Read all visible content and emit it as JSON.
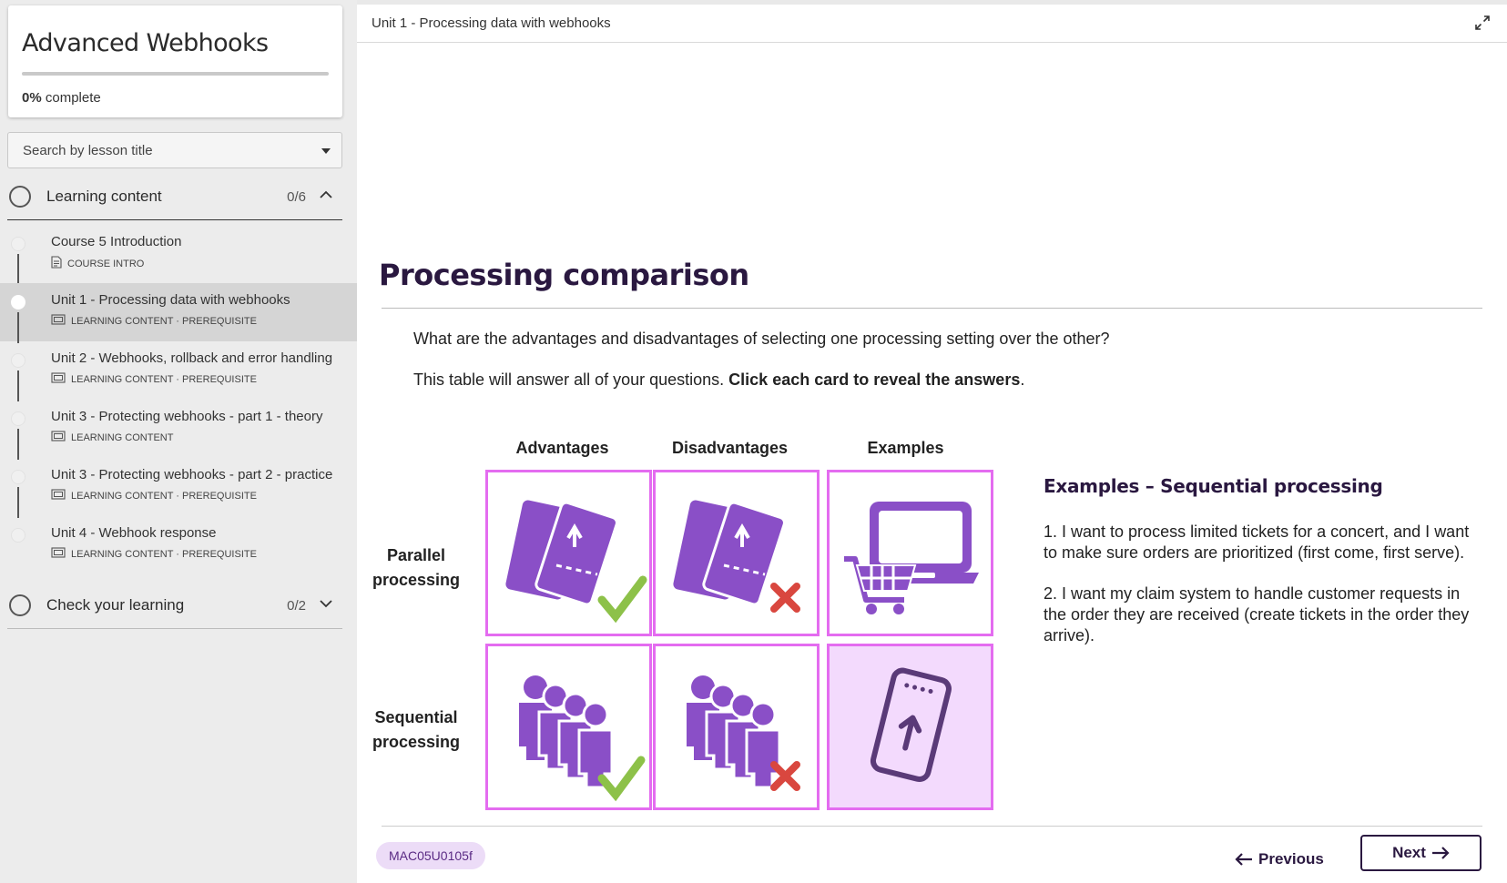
{
  "course": {
    "title": "Advanced Webhooks",
    "progress_percent": 0,
    "progress_value": "0%",
    "progress_suffix": "complete"
  },
  "search": {
    "placeholder": "Search by lesson title"
  },
  "sections": [
    {
      "label": "Learning content",
      "count": "0/6",
      "expanded": true
    },
    {
      "label": "Check your learning",
      "count": "0/2",
      "expanded": false
    }
  ],
  "lessons": [
    {
      "title": "Course 5 Introduction",
      "meta": "COURSE INTRO",
      "icon": "document-icon",
      "active": false
    },
    {
      "title": "Unit 1 - Processing data with webhooks",
      "meta": "LEARNING CONTENT · PREREQUISITE",
      "icon": "slides-icon",
      "active": true
    },
    {
      "title": "Unit 2 - Webhooks, rollback and error handling",
      "meta": "LEARNING CONTENT · PREREQUISITE",
      "icon": "slides-icon",
      "active": false
    },
    {
      "title": "Unit 3 - Protecting webhooks - part 1 - theory",
      "meta": "LEARNING CONTENT",
      "icon": "slides-icon",
      "active": false
    },
    {
      "title": "Unit 3 - Protecting webhooks - part 2 - practice",
      "meta": "LEARNING CONTENT · PREREQUISITE",
      "icon": "slides-icon",
      "active": false
    },
    {
      "title": "Unit 4 - Webhook response",
      "meta": "LEARNING CONTENT · PREREQUISITE",
      "icon": "slides-icon",
      "active": false
    }
  ],
  "topbar": {
    "unit_title": "Unit 1 - Processing data with webhooks"
  },
  "content": {
    "heading": "Processing comparison",
    "question": "What are the advantages and disadvantages of selecting one processing setting over the other?",
    "instruction_prefix": "This table will answer all of your questions. ",
    "instruction_bold": "Click each card to reveal the answers",
    "instruction_suffix": ".",
    "columns": [
      "Advantages",
      "Disadvantages",
      "Examples"
    ],
    "rows": [
      {
        "line1": "Parallel",
        "line2": "processing"
      },
      {
        "line1": "Sequential",
        "line2": "processing"
      }
    ],
    "examples_title": "Examples – Sequential processing",
    "examples": [
      "1. I want to process limited tickets for a concert, and I want to make sure orders are prioritized (first come, first serve).",
      "2. I want my claim system to handle customer requests in the order they are received (create tickets in the order they arrive)."
    ]
  },
  "footer": {
    "lesson_code": "MAC05U0105f",
    "previous_label": "Previous",
    "next_label": "Next"
  },
  "colors": {
    "brand_dark": "#2a1840",
    "brand_purple": "#8a4fc7",
    "card_border": "#e46cf0",
    "card_selected": "#f3dafd",
    "check_green": "#8dc149",
    "cross_red": "#d9473f"
  }
}
